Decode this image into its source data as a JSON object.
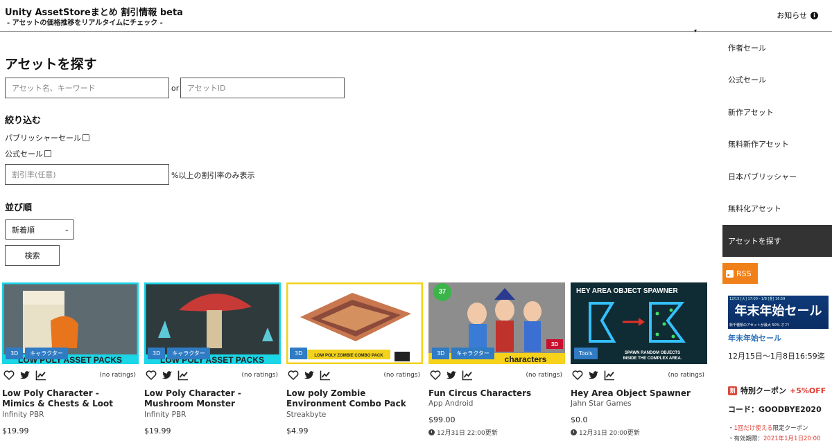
{
  "header": {
    "title": "Unity AssetStoreまとめ 割引情報 beta",
    "subtitle": "- アセットの価格推移をリアルタイムにチェック -",
    "notice_label": "お知らせ"
  },
  "search": {
    "heading": "アセットを探す",
    "keyword_placeholder": "アセット名、キーワード",
    "or_label": "or",
    "id_placeholder": "アセットID"
  },
  "filter": {
    "heading": "絞り込む",
    "publisher_sale_label": "パブリッシャーセール",
    "publisher_sale_checked": false,
    "official_sale_label": "公式セール",
    "official_sale_checked": false,
    "discount_placeholder": "割引率(任意)",
    "discount_suffix": "%以上の割引率のみ表示"
  },
  "sort": {
    "heading": "並び順",
    "selected": "新着順",
    "search_button": "検索"
  },
  "accent": {
    "tag_blue": "#2f7bc4",
    "rss_orange": "#f0811a",
    "sidebar_active": "#333333",
    "link_blue": "#2b6fb8",
    "sale_red": "#e03a2f"
  },
  "cards": [
    {
      "tags": [
        "3D",
        "キャラクター"
      ],
      "ratings": "(no ratings)",
      "title": "Low Poly Character - Mimics & Chests & Loot",
      "publisher": "Infinity PBR",
      "price": "$19.99",
      "updated": "",
      "thumb_caption": "LOW POLY ASSET PACKS"
    },
    {
      "tags": [
        "3D",
        "キャラクター"
      ],
      "ratings": "(no ratings)",
      "title": "Low Poly Character - Mushroom Monster",
      "publisher": "Infinity PBR",
      "price": "$19.99",
      "updated": "",
      "thumb_caption": "LOW POLY ASSET PACKS"
    },
    {
      "tags": [
        "3D"
      ],
      "ratings": "(no ratings)",
      "title": "Low poly Zombie Environment Combo Pack",
      "publisher": "Streakbyte",
      "price": "$4.99",
      "updated": "",
      "thumb_caption": "LOW POLY ZOMBIE COMBO PACK"
    },
    {
      "tags": [
        "3D",
        "キャラクター"
      ],
      "ratings": "(no ratings)",
      "title": "Fun Circus Characters",
      "publisher": "App Android",
      "price": "$99.00",
      "updated": "12月31日 22:00更新",
      "thumb_caption": "characters"
    },
    {
      "tags": [
        "Tools"
      ],
      "ratings": "(no ratings)",
      "title": "Hey Area Object Spawner",
      "publisher": "Jahn Star Games",
      "price": "$0.0",
      "updated": "12月31日 20:00更新",
      "thumb_caption": "HEY AREA OBJECT SPAWNER"
    }
  ],
  "sidebar": {
    "items": [
      "作者セール",
      "公式セール",
      "新作アセット",
      "無料新作アセット",
      "日本パブリッシャー",
      "無料化アセット",
      "アセットを探す"
    ],
    "active_index": 6,
    "rss_label": "RSS",
    "banner_main": "年末年始セール",
    "banner_top": "12/15 [火] 17:00 - 1/8 [金] 16:59",
    "banner_bottom": "新千種類のアセットが最大 50% オフ!",
    "banner_link": "年末年始セール",
    "sale_period": "12月15日〜1月8日16:59迄",
    "coupon_label": "特別クーポン",
    "coupon_off": "+5%OFF",
    "coupon_code": "コード：GOODBYE2020",
    "coupon_note1_prefix": "・",
    "coupon_note1_red": "1回だけ使える",
    "coupon_note1_rest": "限定クーポン",
    "coupon_note2_prefix": "・有効期限：",
    "coupon_note2_red": "2021年1月1日20:00"
  }
}
